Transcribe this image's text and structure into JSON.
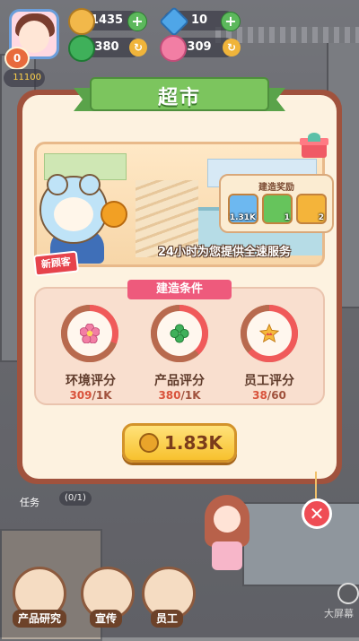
{
  "hud": {
    "level": "0",
    "coins": "1435",
    "gems": "10",
    "clover": "380",
    "flower": "309",
    "energy": "11100"
  },
  "modal": {
    "title": "超市",
    "banner_caption": "24小时为您提供全速服务",
    "new_customer_tag": "新顾客",
    "rewards": {
      "title": "建造奖励",
      "items": [
        {
          "icon": "crown-card-icon",
          "count": "1.31K"
        },
        {
          "icon": "lightning-card-icon",
          "count": "1"
        },
        {
          "icon": "mystery-card-icon",
          "count": "2"
        }
      ]
    },
    "conditions": {
      "title": "建造条件",
      "items": [
        {
          "icon": "flower-icon",
          "label": "环境评分",
          "current": "309",
          "required": "1K",
          "progress": 0.309
        },
        {
          "icon": "clover-icon",
          "label": "产品评分",
          "current": "380",
          "required": "1K",
          "progress": 0.38
        },
        {
          "icon": "crown-star-icon",
          "label": "员工评分",
          "current": "38",
          "required": "60",
          "progress": 0.633
        }
      ]
    },
    "build_cost": "1.83K"
  },
  "bottom": {
    "task_label": "任务",
    "task_progress": "(0/1)",
    "buttons": [
      "产品研究",
      "宣传",
      "员工"
    ],
    "corner_text": "大屏幕"
  },
  "colors": {
    "ring_track": "#b86a4e",
    "ring_fill": "#f05a5a",
    "ribbon": "#7cc55e",
    "button_gold": "#f7c12e"
  }
}
